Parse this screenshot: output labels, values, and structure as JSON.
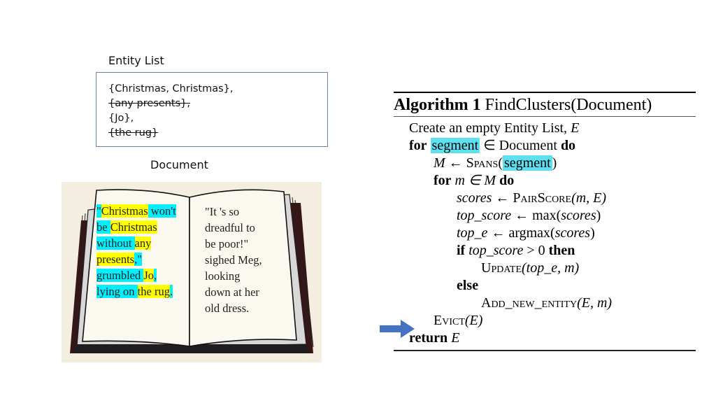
{
  "entity_list": {
    "title": "Entity List",
    "items": [
      {
        "text": "{Christmas, Christmas},",
        "struck": false
      },
      {
        "text": "{any presents},",
        "struck": true
      },
      {
        "text": "{Jo},",
        "struck": false
      },
      {
        "text": "{the rug}",
        "struck": true
      }
    ]
  },
  "document": {
    "title": "Document",
    "left_page": {
      "lines": [
        [
          {
            "t": "\"",
            "hl": "cyan"
          },
          {
            "t": "Christmas",
            "hl": "yellow"
          },
          {
            "t": " won't",
            "hl": "cyan"
          }
        ],
        [
          {
            "t": "be ",
            "hl": "cyan"
          },
          {
            "t": "Christmas",
            "hl": "yellow"
          },
          {
            "t": " ",
            "hl": "cyan"
          }
        ],
        [
          {
            "t": "without ",
            "hl": "cyan"
          },
          {
            "t": "any",
            "hl": "yellow"
          }
        ],
        [
          {
            "t": "presents",
            "hl": "yellow"
          },
          {
            "t": ",\"",
            "hl": "cyan"
          }
        ],
        [
          {
            "t": "grumbled ",
            "hl": "cyan"
          },
          {
            "t": "Jo",
            "hl": "yellow"
          },
          {
            "t": ",",
            "hl": "cyan"
          }
        ],
        [
          {
            "t": "lying on ",
            "hl": "cyan"
          },
          {
            "t": "the rug",
            "hl": "yellow"
          },
          {
            "t": ".",
            "hl": "cyan"
          }
        ]
      ]
    },
    "right_page": {
      "lines": [
        "\"It 's so",
        "dreadful to",
        "be poor!\"",
        "sighed Meg,",
        "looking",
        "down at her",
        "old dress."
      ]
    },
    "colors": {
      "yellow": "#ffff00",
      "cyan": "#00f0ff"
    }
  },
  "algorithm": {
    "label": "Algorithm 1",
    "name": "FindClusters(Document)",
    "lines": {
      "l1": "Create an empty Entity List, ",
      "l1_var": "E",
      "for": "for",
      "segment": "segment",
      "in_document": " ∈ Document ",
      "do": "do",
      "M": "M",
      "arrow_assign": " ← ",
      "spans": "Spans",
      "open": "(",
      "close": ")",
      "m_in_M": " m ∈ M ",
      "scores": "scores",
      "pairscore": "PairScore",
      "pairscore_args": "(m, E)",
      "top_score": "top_score",
      "max": "max(",
      "top_e": "top_e",
      "argmax": "argmax(",
      "if": "if",
      "gt0": " > 0 ",
      "then": "then",
      "update": "Update",
      "update_args": "(top_e, m)",
      "else": "else",
      "add_new_entity": "Add_new_entity",
      "add_args": "(E, m)",
      "evict": "Evict",
      "evict_args": "(E)",
      "return": "return",
      "return_var": " E"
    },
    "highlight_color": "#5fe0f0",
    "pointer": {
      "icon": "right-arrow-icon",
      "color": "#4472c4",
      "points_to": "Evict(E)"
    }
  }
}
